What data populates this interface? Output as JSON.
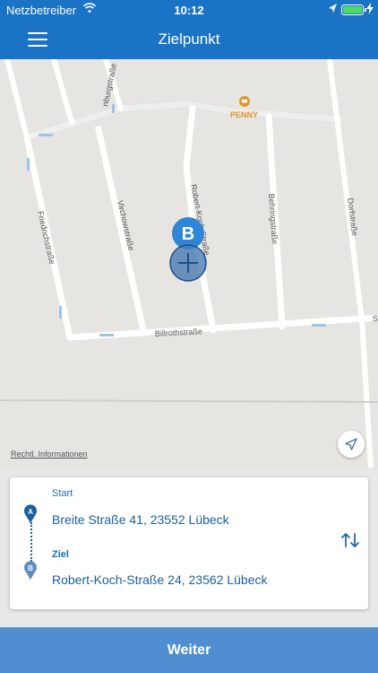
{
  "status_bar": {
    "carrier": "Netzbetreiber",
    "time": "10:12",
    "icons": [
      "wifi-icon",
      "location-arrow-icon",
      "battery-icon",
      "charging-bolt-icon"
    ]
  },
  "header": {
    "title": "Zielpunkt",
    "menu_icon": "hamburger-menu-icon"
  },
  "map": {
    "streets": [
      "nburgstraße",
      "Friedrichstraße",
      "Virchowstraße",
      "Robert-Koch-Straße",
      "Behringstraße",
      "Dorfstraße",
      "Billrothstraße",
      "S"
    ],
    "poi": {
      "label": "PENNY",
      "icon": "shopping-cart-icon",
      "color": "#e0962a"
    },
    "pin_letter": "B",
    "pin_color": "#2f86d6",
    "legal_link": "Rechtl. Informationen",
    "locate_icon": "location-arrow-icon"
  },
  "route": {
    "start_label": "Start",
    "start_marker": "A",
    "start_address": "Breite Straße 41, 23552 Lübeck",
    "end_label": "Ziel",
    "end_marker": "B",
    "end_address": "Robert-Koch-Straße 24, 23562 Lübeck",
    "swap_icon": "swap-arrows-icon"
  },
  "footer": {
    "button_label": "Weiter"
  },
  "colors": {
    "brand_blue": "#1a73c5",
    "button_blue": "#4f8fd1",
    "text_blue": "#1b5fa0"
  }
}
